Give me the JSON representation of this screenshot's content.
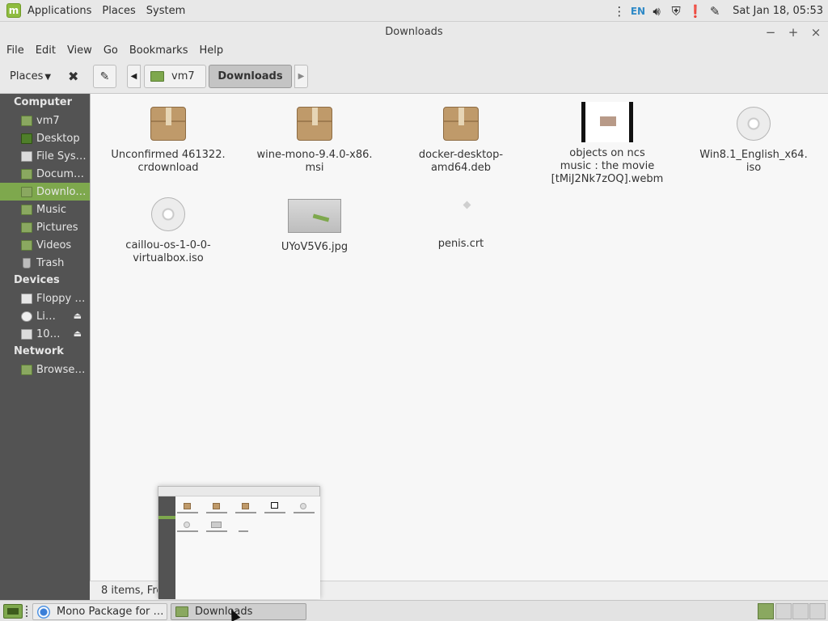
{
  "top_panel": {
    "menus": [
      "Applications",
      "Places",
      "System"
    ],
    "keyboard_layout": "EN",
    "clock": "Sat Jan 18, 05:53"
  },
  "window": {
    "title": "Downloads",
    "minimize": "−",
    "maximize": "+",
    "close": "×"
  },
  "menubar": [
    "File",
    "Edit",
    "View",
    "Go",
    "Bookmarks",
    "Help"
  ],
  "toolbar": {
    "places_label": "Places",
    "breadcrumb": [
      "vm7",
      "Downloads"
    ]
  },
  "sidebar": {
    "sections": [
      {
        "heading": "Computer",
        "items": [
          {
            "label": "vm7",
            "icon": "home-folder-icon"
          },
          {
            "label": "Desktop",
            "icon": "desktop-icon"
          },
          {
            "label": "File Syst…",
            "icon": "drive-icon"
          },
          {
            "label": "Docum…",
            "icon": "folder-icon"
          },
          {
            "label": "Downlo…",
            "icon": "folder-icon",
            "active": true
          },
          {
            "label": "Music",
            "icon": "folder-icon"
          },
          {
            "label": "Pictures",
            "icon": "folder-icon"
          },
          {
            "label": "Videos",
            "icon": "folder-icon"
          },
          {
            "label": "Trash",
            "icon": "trash-icon"
          }
        ]
      },
      {
        "heading": "Devices",
        "items": [
          {
            "label": "Floppy …",
            "icon": "floppy-icon"
          },
          {
            "label": "Li…",
            "icon": "disc-icon",
            "eject": true
          },
          {
            "label": "10…",
            "icon": "drive-icon",
            "eject": true
          }
        ]
      },
      {
        "heading": "Network",
        "items": [
          {
            "label": "Browse …",
            "icon": "network-icon"
          }
        ]
      }
    ]
  },
  "files": [
    {
      "name": "Unconfirmed 461322.\ncrdownload",
      "type": "package"
    },
    {
      "name": "wine-mono-9.4.0-x86.\nmsi",
      "type": "package"
    },
    {
      "name": "docker-desktop-\namd64.deb",
      "type": "package"
    },
    {
      "name": "objects on ncs\nmusic : the movie\n[tMiJ2Nk7zOQ].webm",
      "type": "video"
    },
    {
      "name": "Win8.1_English_x64.\niso",
      "type": "disc"
    },
    {
      "name": "caillou-os-1-0-0-\nvirtualbox.iso",
      "type": "disc"
    },
    {
      "name": "UYoV5V6.jpg",
      "type": "image"
    },
    {
      "name": "penis.crt",
      "type": "certificate"
    }
  ],
  "status": "8 items, Fre",
  "taskbar": {
    "tasks": [
      {
        "label": "Mono Package for …",
        "icon": "chrome-icon"
      },
      {
        "label": "Downloads",
        "icon": "folder-icon",
        "active": true
      }
    ]
  },
  "colors": {
    "accent": "#7ea84d",
    "sidebar_bg": "#535353",
    "content_bg": "#f7f7f7"
  }
}
